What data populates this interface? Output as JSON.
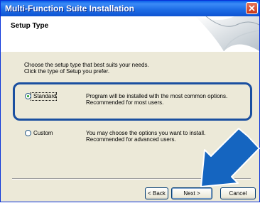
{
  "window": {
    "title": "Multi-Function Suite Installation"
  },
  "header": {
    "title": "Setup Type"
  },
  "intro": {
    "line1": "Choose the setup type that best suits your needs.",
    "line2": "Click the type of Setup you prefer."
  },
  "options": [
    {
      "label": "Standard",
      "selected": true,
      "desc_line1": "Program will be installed with the most common options.",
      "desc_line2": "Recommended for most users."
    },
    {
      "label": "Custom",
      "selected": false,
      "desc_line1": "You may choose the options you want to install.",
      "desc_line2": "Recommended for advanced users."
    }
  ],
  "buttons": {
    "back": "< Back",
    "next": "Next >",
    "cancel": "Cancel"
  },
  "colors": {
    "titlebar": "#0a5fe8",
    "highlight_border": "#1a4fa0",
    "arrow": "#1565c0"
  }
}
